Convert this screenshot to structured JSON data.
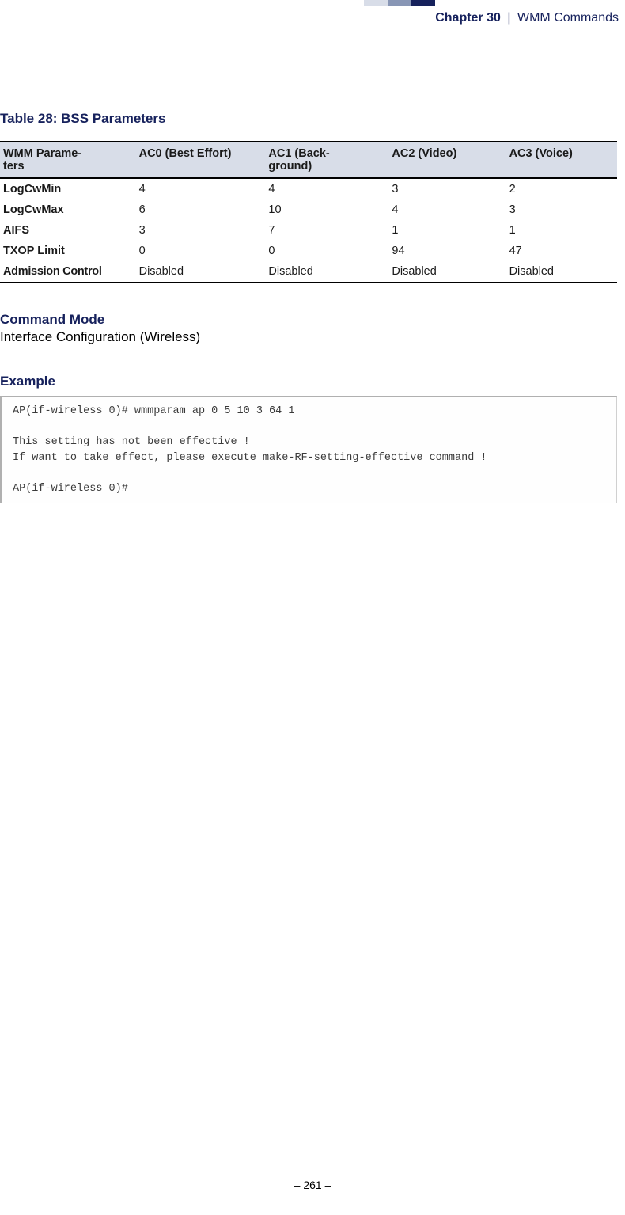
{
  "header": {
    "chapter": "Chapter 30",
    "separator": "|",
    "subtitle": "WMM Commands"
  },
  "table": {
    "title": "Table 28: BSS Parameters",
    "headers": [
      "WMM Parame-\nters",
      "AC0 (Best Effort)",
      "AC1 (Back-\nground)",
      "AC2 (Video)",
      "AC3 (Voice)"
    ],
    "rows": [
      {
        "label": "LogCwMin",
        "c1": "4",
        "c2": "4",
        "c3": "3",
        "c4": "2"
      },
      {
        "label": "LogCwMax",
        "c1": "6",
        "c2": "10",
        "c3": "4",
        "c4": "3"
      },
      {
        "label": "AIFS",
        "c1": "3",
        "c2": "7",
        "c3": "1",
        "c4": "1"
      },
      {
        "label": "TXOP Limit",
        "c1": "0",
        "c2": "0",
        "c3": "94",
        "c4": "47"
      },
      {
        "label": "Admission Control",
        "c1": "Disabled",
        "c2": "Disabled",
        "c3": "Disabled",
        "c4": "Disabled"
      }
    ]
  },
  "command_mode": {
    "heading": "Command Mode",
    "body": "Interface Configuration (Wireless)"
  },
  "example": {
    "heading": "Example",
    "code": "AP(if-wireless 0)# wmmparam ap 0 5 10 3 64 1\n\nThis setting has not been effective !\nIf want to take effect, please execute make-RF-setting-effective command !\n\nAP(if-wireless 0)#"
  },
  "footer": {
    "page": "–  261  –"
  }
}
